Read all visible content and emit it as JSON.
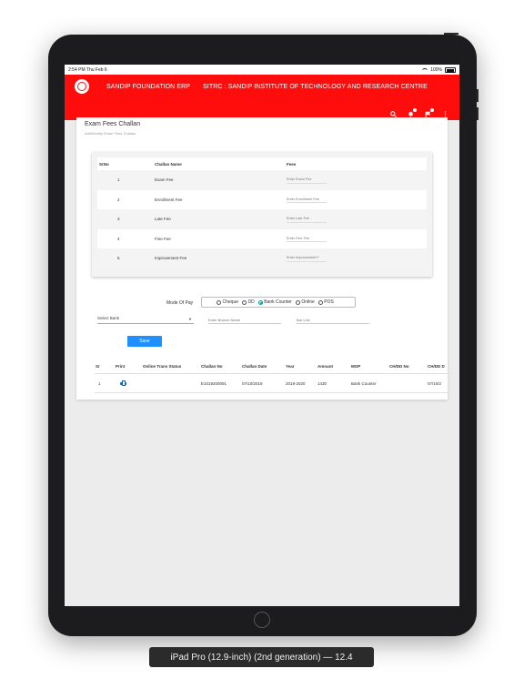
{
  "status_bar": {
    "time": "2:54 PM  Thu Feb 6",
    "battery": "100%"
  },
  "app_bar": {
    "org_title": "SANDIP FOUNDATION ERP",
    "institute_title": "SITRC : SANDIP INSTITUTE OF TECHNOLOGY AND RESEARCH CENTRE",
    "icons": [
      "search-icon",
      "notification-icon",
      "flag-icon",
      "more-vert-icon"
    ],
    "brand_color": "#ff0d0d"
  },
  "page": {
    "title": "Exam Fees Challan",
    "subtitle": "Add/Modify Exam Fees Challan"
  },
  "fee_table": {
    "headers": [
      "SrNo",
      "Challan Name",
      "Fees"
    ],
    "rows": [
      {
        "no": "1",
        "name": "Exam Fee",
        "placeholder": "Enter Exam Fee"
      },
      {
        "no": "2",
        "name": "Enrollment Fee",
        "placeholder": "Enter Enrollment Fee"
      },
      {
        "no": "3",
        "name": "Late Fee",
        "placeholder": "Enter Late Fee"
      },
      {
        "no": "4",
        "name": "Fine Fee",
        "placeholder": "Enter Fine Fee"
      },
      {
        "no": "5",
        "name": "Improvement Fee",
        "placeholder": "Enter Improvement F"
      }
    ]
  },
  "payment": {
    "label": "Mode Of Pay",
    "options": [
      "Cheque",
      "DD",
      "Bank Counter",
      "Online",
      "POS"
    ],
    "selected": "Bank Counter"
  },
  "bank": {
    "select_placeholder": "Select Bank",
    "branch_placeholder": "Enter Branch Name",
    "second_placeholder": "Bar Link"
  },
  "save_label": "Save",
  "grid": {
    "headers": [
      "Sr",
      "Print",
      "Online Trans Status",
      "Challan No",
      "Challan Date",
      "Year",
      "Amount",
      "MOP",
      "CH/DD No",
      "CH/DD D"
    ],
    "rows": [
      {
        "sr": "1",
        "status": "",
        "challan_no": "E1019200091",
        "date": "07/10/2019",
        "year": "2019-2020",
        "amount": "1430",
        "mop": "Bank Counter",
        "chdd_no": "",
        "chdd_date": "07/10/2"
      }
    ]
  },
  "caption": "iPad Pro (12.9-inch) (2nd generation) — 12.4"
}
